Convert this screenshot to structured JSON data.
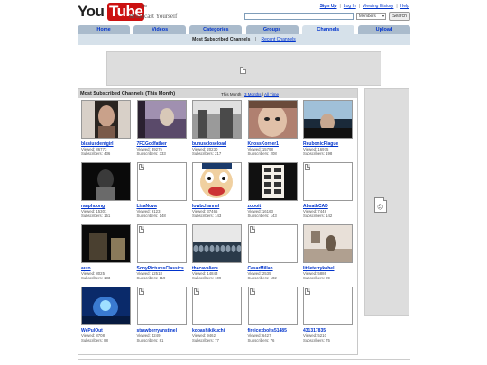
{
  "logo": {
    "you": "You",
    "tube": "Tube",
    "tm": "TM",
    "tagline": "Broadcast Yourself"
  },
  "toplinks": [
    {
      "label": "Sign Up",
      "bold": true
    },
    {
      "label": "Log In",
      "bold": false
    },
    {
      "label": "Viewing History",
      "bold": false
    },
    {
      "label": "Help",
      "bold": false
    }
  ],
  "search": {
    "value": "",
    "select": "Members",
    "button": "Search"
  },
  "nav": {
    "tabs": [
      {
        "label": "Home",
        "active": false
      },
      {
        "label": "Videos",
        "active": false
      },
      {
        "label": "Categories",
        "active": false
      },
      {
        "label": "Groups",
        "active": false
      },
      {
        "label": "Channels",
        "active": true
      },
      {
        "label": "Upload",
        "active": false
      }
    ],
    "sub": {
      "current": "Most Subscribed Channels",
      "other": "Recent Channels"
    }
  },
  "main": {
    "title": "Most Subscribed Channels (This Month)",
    "periods": {
      "current": "This Month",
      "others": [
        "3 Months",
        "All Time"
      ]
    }
  },
  "channels": [
    {
      "name": "blasiusdentgirl",
      "viewed": "Viewed: 86773",
      "subscribers": "Subscribers: 436",
      "thumb": "girl-portrait",
      "colors": [
        "#2a2420",
        "#7a5a4a",
        "#c9a18a"
      ]
    },
    {
      "name": "7FCGodfather",
      "viewed": "Viewed: 39275",
      "subscribers": "Subscribers: 333",
      "thumb": "train-window",
      "colors": [
        "#5a4a6a",
        "#a090b0",
        "#d8c8b8"
      ]
    },
    {
      "name": "bunuscloseload",
      "viewed": "Viewed: 20230",
      "subscribers": "Subscribers: 217",
      "thumb": "street-scene",
      "colors": [
        "#4a4a4a",
        "#9a9a9a",
        "#e0e0e0"
      ]
    },
    {
      "name": "KnossKorner1",
      "viewed": "Viewed: 15798",
      "subscribers": "Subscribers: 208",
      "thumb": "face-closeup",
      "colors": [
        "#6a4a3a",
        "#b08070",
        "#e0c0a8"
      ]
    },
    {
      "name": "ReubonicPlague",
      "viewed": "Viewed: 16975",
      "subscribers": "Subscribers: 198",
      "thumb": "car-driver",
      "colors": [
        "#1a2a3a",
        "#4a6a8a",
        "#a0c0d8"
      ]
    },
    {
      "name": "ranphuong",
      "viewed": "Viewed: 15301",
      "subscribers": "Subscribers: 151",
      "thumb": "dark-figure",
      "colors": [
        "#0a0a0a",
        "#3a3a3a",
        "#6a6a6a"
      ]
    },
    {
      "name": "LisaNova",
      "viewed": "Viewed: 9123",
      "subscribers": "Subscribers: 148",
      "thumb": "none",
      "colors": []
    },
    {
      "name": "lowbchannel",
      "viewed": "Viewed: 37465",
      "subscribers": "Subscribers: 143",
      "thumb": "cartoon-face",
      "colors": [
        "#1a3a6a",
        "#f0d0a0",
        "#ffffff"
      ]
    },
    {
      "name": "zoooit",
      "viewed": "Viewed: 16163",
      "subscribers": "Subscribers: 143",
      "thumb": "kanji-panel",
      "colors": [
        "#111111",
        "#f4f0e8",
        "#333333"
      ]
    },
    {
      "name": "AbsathCAD",
      "viewed": "Viewed: 7448",
      "subscribers": "Subscribers: 142",
      "thumb": "none",
      "colors": []
    },
    {
      "name": "auto",
      "viewed": "Viewed: 8025",
      "subscribers": "Subscribers: 133",
      "thumb": "piano-room",
      "colors": [
        "#0a0a0a",
        "#4a4030",
        "#8a7a5a"
      ]
    },
    {
      "name": "SonyPicturesClassics",
      "viewed": "Viewed: 12518",
      "subscribers": "Subscribers: 119",
      "thumb": "none",
      "colors": []
    },
    {
      "name": "thecavaliers",
      "viewed": "Viewed: 14843",
      "subscribers": "Subscribers: 109",
      "thumb": "stage-crowd",
      "colors": [
        "#2a3a4a",
        "#8a9aaa",
        "#e8e8e8"
      ]
    },
    {
      "name": "CesarMillan",
      "viewed": "Viewed: 2535",
      "subscribers": "Subscribers: 102",
      "thumb": "none",
      "colors": []
    },
    {
      "name": "littleterrykohel",
      "viewed": "Viewed: 5886",
      "subscribers": "Subscribers: 89",
      "thumb": "guitar-room",
      "colors": [
        "#6a5a4a",
        "#b0a090",
        "#e8e0d8"
      ]
    },
    {
      "name": "WePulOut",
      "viewed": "Viewed: 8708",
      "subscribers": "Subscribers: 88",
      "thumb": "game-blue",
      "colors": [
        "#0a2a6a",
        "#3a7ad0",
        "#a0e0ff"
      ]
    },
    {
      "name": "strawberryanstinel",
      "viewed": "Viewed: 4249",
      "subscribers": "Subscribers: 81",
      "thumb": "none",
      "colors": []
    },
    {
      "name": "kobashikikuchi",
      "viewed": "Viewed: 9462",
      "subscribers": "Subscribers: 77",
      "thumb": "none",
      "colors": []
    },
    {
      "name": "fireicexbolts51485",
      "viewed": "Viewed: 6427",
      "subscribers": "Subscribers: 76",
      "thumb": "none",
      "colors": []
    },
    {
      "name": "431317835",
      "viewed": "Viewed: 5210",
      "subscribers": "Subscribers: 75",
      "thumb": "none",
      "colors": []
    }
  ]
}
